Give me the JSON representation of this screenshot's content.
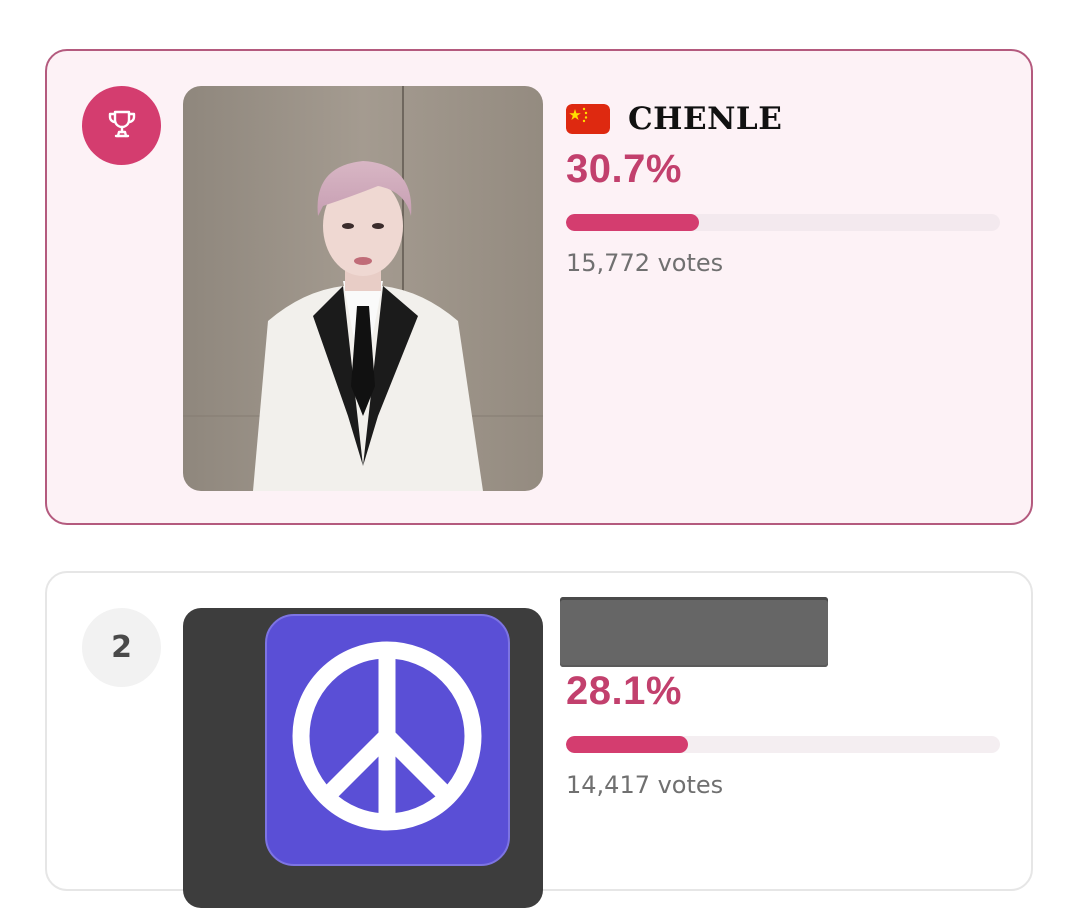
{
  "colors": {
    "accent": "#d43d6f",
    "accent_text": "#c2406d",
    "first_card_bg": "#fdf2f6",
    "first_card_border": "#b45a7e",
    "peace_purple": "#5a4fd6"
  },
  "entries": [
    {
      "rank_icon": "trophy-icon",
      "flag": "china-flag-icon",
      "name": "CHENLE",
      "percent": "30.7%",
      "share": 0.307,
      "votes": "15,772 votes"
    },
    {
      "rank": "2",
      "name_redacted": true,
      "percent": "28.1%",
      "share": 0.281,
      "votes": "14,417 votes",
      "image_icon": "peace-sign-icon"
    }
  ]
}
